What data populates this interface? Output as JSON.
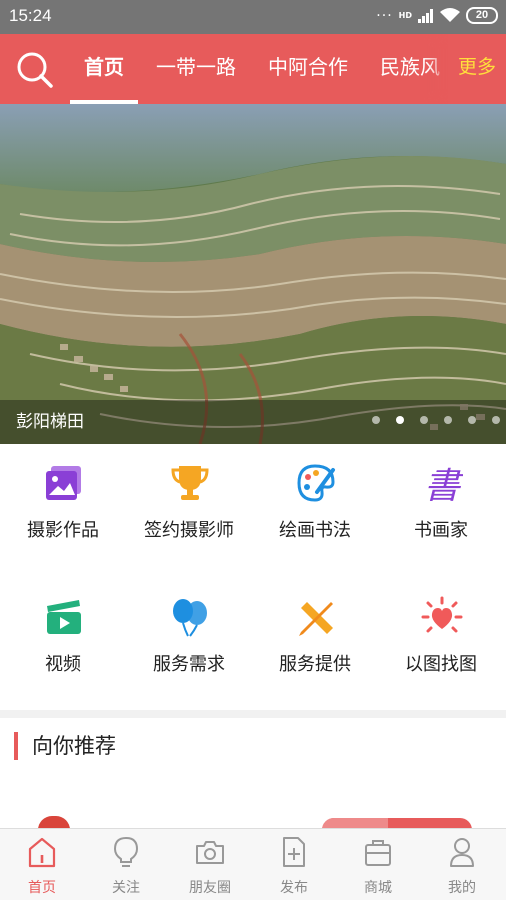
{
  "status_bar": {
    "time": "15:24",
    "network": "HD",
    "battery": "20"
  },
  "top_nav": {
    "tabs": [
      {
        "label": "首页",
        "active": true
      },
      {
        "label": "一带一路",
        "active": false
      },
      {
        "label": "中阿合作",
        "active": false
      },
      {
        "label": "民族风",
        "active": false
      }
    ],
    "more_label": "更多"
  },
  "banner": {
    "caption": "彭阳梯田",
    "slide_count": 6,
    "active_index": 1
  },
  "grid": {
    "items": [
      {
        "label": "摄影作品",
        "icon": "photo-works-icon"
      },
      {
        "label": "签约摄影师",
        "icon": "trophy-icon"
      },
      {
        "label": "绘画书法",
        "icon": "palette-icon"
      },
      {
        "label": "书画家",
        "icon": "calligraphy-icon"
      },
      {
        "label": "视频",
        "icon": "video-clapper-icon"
      },
      {
        "label": "服务需求",
        "icon": "balloons-icon"
      },
      {
        "label": "服务提供",
        "icon": "pencil-ruler-icon"
      },
      {
        "label": "以图找图",
        "icon": "heart-sun-icon"
      }
    ]
  },
  "recommend": {
    "title": "向你推荐"
  },
  "bottom_nav": {
    "items": [
      {
        "label": "首页",
        "icon": "home-icon",
        "active": true
      },
      {
        "label": "关注",
        "icon": "bulb-icon",
        "active": false
      },
      {
        "label": "朋友圈",
        "icon": "camera-icon",
        "active": false
      },
      {
        "label": "发布",
        "icon": "publish-icon",
        "active": false
      },
      {
        "label": "商城",
        "icon": "shop-icon",
        "active": false
      },
      {
        "label": "我的",
        "icon": "profile-icon",
        "active": false
      }
    ]
  },
  "colors": {
    "brand": "#e75b5b",
    "more": "#ffde3c",
    "status_bar": "#757575"
  }
}
